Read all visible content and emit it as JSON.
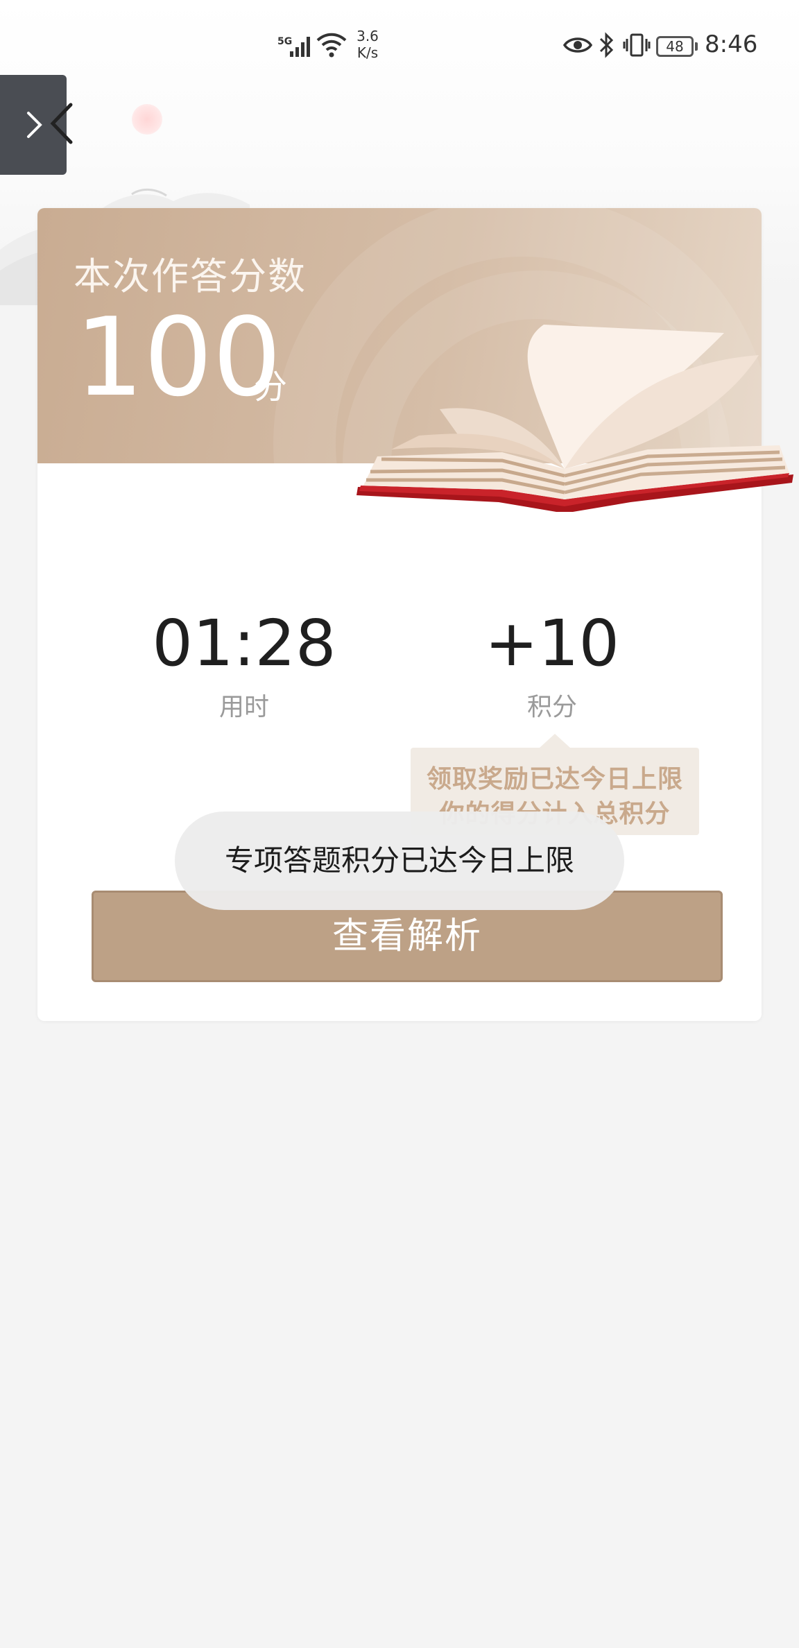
{
  "status_bar": {
    "network_tag": "5G",
    "speed_value": "3.6",
    "speed_unit": "K/s",
    "battery": "48",
    "time": "8:46",
    "icons": [
      "signal-icon",
      "wifi-icon",
      "eye-icon",
      "bluetooth-icon",
      "vibrate-icon",
      "battery-icon"
    ]
  },
  "result": {
    "score_label": "本次作答分数",
    "score_value": "100",
    "score_unit": "分",
    "stats": [
      {
        "value": "01:28",
        "label": "用时"
      },
      {
        "value": "+10",
        "label": "积分"
      }
    ],
    "reward_tip": {
      "line1": "领取奖励已达今日上限",
      "line2": "你的得分计入总积分"
    },
    "analysis_button": "查看解析"
  },
  "toast": "专项答题积分已达今日上限",
  "colors": {
    "header_gradient_start": "#c9ac92",
    "header_gradient_end": "#e6d6c6",
    "button_bg": "#bda186",
    "tip_text": "#c9a98c",
    "page_bg": "#f4f4f4"
  }
}
